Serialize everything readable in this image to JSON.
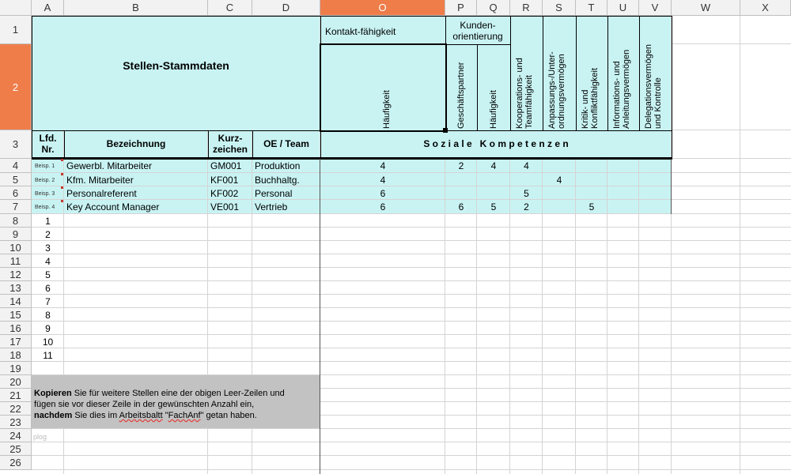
{
  "columns": [
    "A",
    "B",
    "C",
    "D",
    "O",
    "P",
    "Q",
    "R",
    "S",
    "T",
    "U",
    "V",
    "W",
    "X"
  ],
  "rows": [
    "1",
    "2",
    "3",
    "4",
    "5",
    "6",
    "7",
    "8",
    "9",
    "10",
    "11",
    "12",
    "13",
    "14",
    "15",
    "16",
    "17",
    "18",
    "19",
    "20",
    "21",
    "22",
    "23",
    "24",
    "25",
    "26"
  ],
  "header": {
    "title": "Stellen-Stammdaten",
    "kontakt": "Kontakt-fähigkeit",
    "kunden1": "Kunden-",
    "kunden2": "orientierung",
    "vertical": {
      "o": "Häufigkeit",
      "p": "Geschäftspartner",
      "q": "Häufigkeit",
      "r1": "Kooperations- und",
      "r2": "Teamfähigkeit",
      "s1": "Anpassungs-/Unter-",
      "s2": "ordnungsvermögen",
      "t1": "Kritik- und",
      "t2": "Konfliktfähigkeit",
      "u1": "Informations- und",
      "u2": "Anleitungsvermögen",
      "v1": "Delegationsvermögen",
      "v2": "und Kontrolle"
    },
    "lfd1": "Lfd.",
    "lfd2": "Nr.",
    "bezeichnung": "Bezeichnung",
    "kurz1": "Kurz-",
    "kurz2": "zeichen",
    "oe": "OE / Team",
    "soziale": "S o z i a l e   K o m p e t e n z e n"
  },
  "examples": [
    {
      "tag": "Beisp. 1",
      "name": "Gewerbl. Mitarbeiter",
      "code": "GM001",
      "oe": "Produktion",
      "o": "4",
      "p": "2",
      "q": "4",
      "r": "4",
      "s": "",
      "t": "",
      "u": "",
      "v": ""
    },
    {
      "tag": "Beisp. 2",
      "name": "Kfm. Mitarbeiter",
      "code": "KF001",
      "oe": "Buchhaltg.",
      "o": "4",
      "p": "",
      "q": "",
      "r": "",
      "s": "4",
      "t": "",
      "u": "",
      "v": ""
    },
    {
      "tag": "Beisp. 3",
      "name": "Personalreferent",
      "code": "KF002",
      "oe": "Personal",
      "o": "6",
      "p": "",
      "q": "",
      "r": "5",
      "s": "",
      "t": "",
      "u": "",
      "v": ""
    },
    {
      "tag": "Beisp. 4",
      "name": "Key Account Manager",
      "code": "VE001",
      "oe": "Vertrieb",
      "o": "6",
      "p": "6",
      "q": "5",
      "r": "2",
      "s": "",
      "t": "5",
      "u": "",
      "v": ""
    }
  ],
  "numbers": [
    "1",
    "2",
    "3",
    "4",
    "5",
    "6",
    "7",
    "8",
    "9",
    "10",
    "11"
  ],
  "note": {
    "w1": "Kopieren",
    "t1": " Sie für weitere Stellen eine der obigen Leer-Zeilen und",
    "t2": "fügen sie vor dieser Zeile in der gewünschten Anzahl ein,",
    "w3": "nachdem",
    "t3a": " Sie dies im ",
    "t3b": "Arbeitsbaltt",
    "t3c": " \"",
    "t3d": "FachAnf",
    "t3e": "\" getan haben."
  },
  "watermark": "plog",
  "colors": {
    "cyan": "#c9f3f3",
    "selected": "#ee7d4a",
    "note_bg": "#c2c2c2"
  }
}
